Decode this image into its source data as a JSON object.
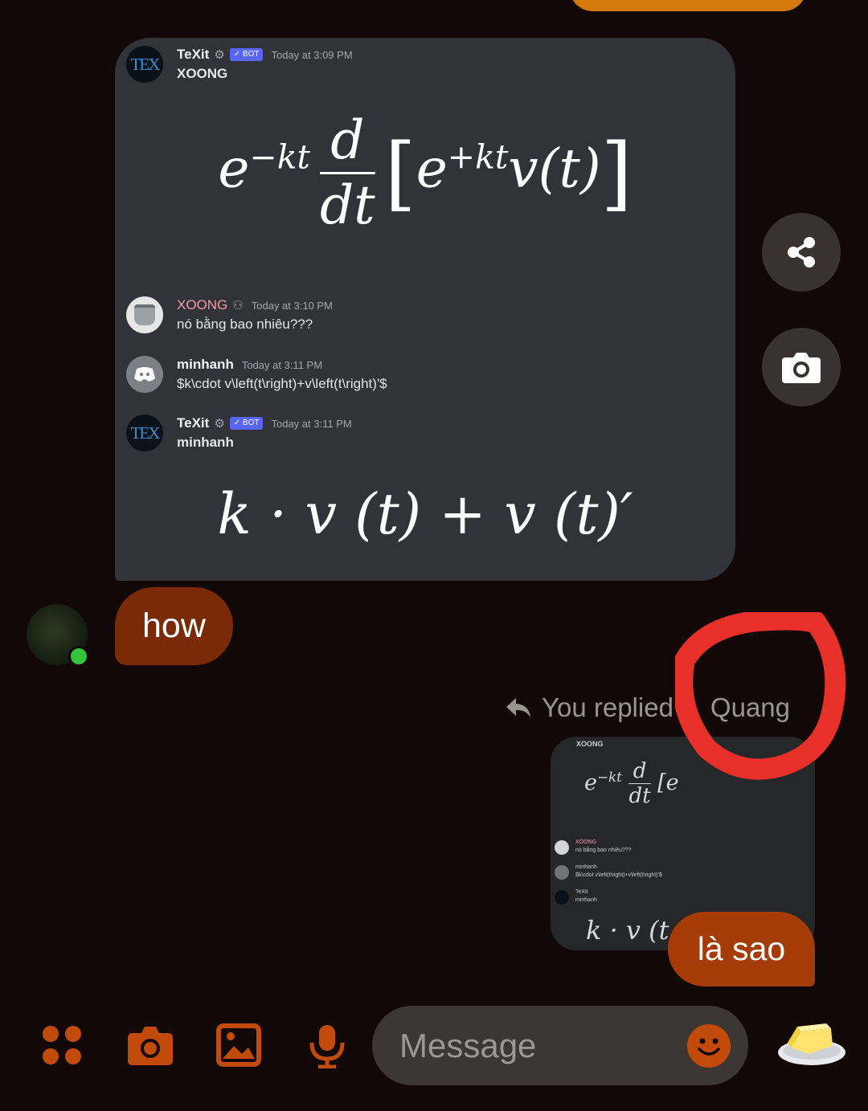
{
  "screenshot_card": {
    "messages": [
      {
        "username": "TeXit",
        "badge": "✓ BOT",
        "time": "Today at 3:09 PM",
        "text": "XOONG"
      },
      {
        "username": "XOONG",
        "time": "Today at 3:10 PM",
        "text": "nó bằng bao nhiêu???"
      },
      {
        "username": "minhanh",
        "time": "Today at 3:11 PM",
        "text": "$k\\cdot v\\left(t\\right)+v\\left(t\\right)'$"
      },
      {
        "username": "TeXit",
        "badge": "✓ BOT",
        "time": "Today at 3:11 PM",
        "text": "minhanh"
      }
    ],
    "avatar_tex_label": "TEX"
  },
  "chat": {
    "incoming_text": "how",
    "reply_label": "You replied",
    "reply_target": "Quang",
    "outgoing_text": "là sao",
    "quote_title": "XOONG",
    "quote_rows": [
      {
        "name": "XOONG",
        "text": "nó bằng bao nhiêu???"
      },
      {
        "name": "minhanh",
        "text": "$k\\cdot v\\left(t\\right)+v\\left(t\\right)'$"
      },
      {
        "name": "TeXit",
        "text": "minhanh"
      }
    ]
  },
  "composer": {
    "placeholder": "Message"
  },
  "colors": {
    "background": "#120807",
    "card": "#313338",
    "incoming_bubble": "#7a2a06",
    "outgoing_bubble": "#a53b06",
    "accent_orange": "#c24a0a",
    "annotation_red": "#e8302a",
    "bot_badge": "#5865f2"
  }
}
